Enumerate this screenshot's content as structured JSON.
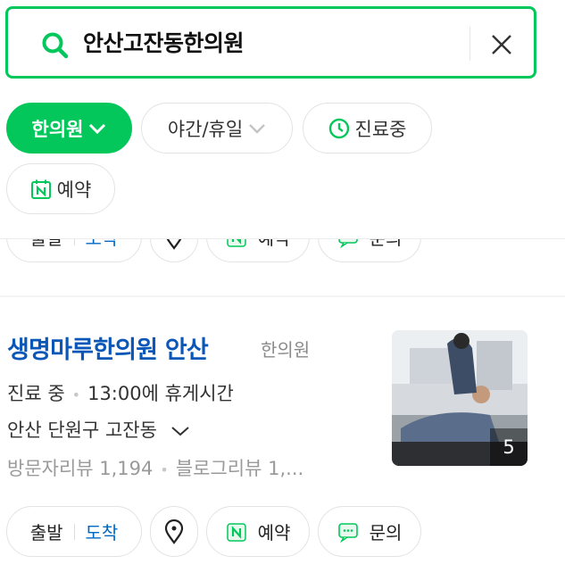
{
  "search": {
    "query": "안산고잔동한의원"
  },
  "filters": {
    "category": "한의원",
    "night_holiday": "야간/휴일",
    "open_now": "진료중",
    "reservation": "예약"
  },
  "actions": {
    "depart": "출발",
    "arrive": "도착",
    "reserve": "예약",
    "inquiry": "문의"
  },
  "place": {
    "name": "생명마루한의원 안산",
    "category": "한의원",
    "status": "진료 중",
    "hours_note": "13:00에 휴게시간",
    "address": "안산 단원구 고잔동",
    "visitor_reviews": "방문자리뷰 1,194",
    "blog_reviews": "블로그리뷰 1,...",
    "photo_count": "5"
  },
  "colors": {
    "brand_green": "#03c75a",
    "link_blue": "#0b57b8",
    "accent_blue": "#0068c3"
  }
}
